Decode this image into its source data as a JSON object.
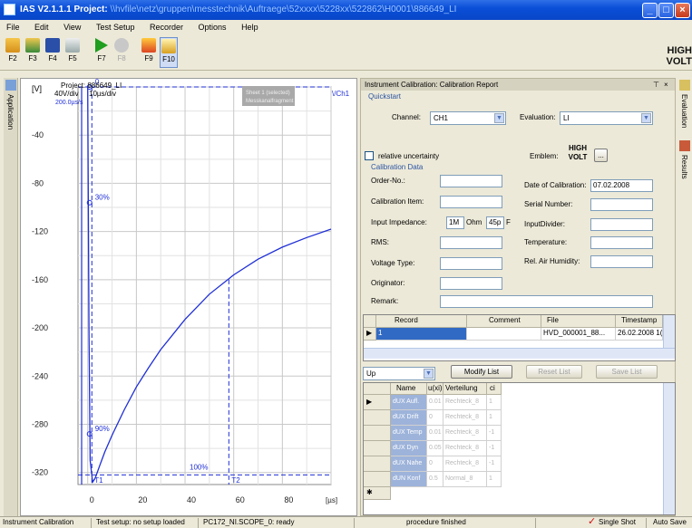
{
  "window": {
    "title_app": "IAS V2.1.1.1 Project: ",
    "title_path": "\\\\hvfile\\netz\\gruppen\\messtechnik\\Auftraege\\52xxxx\\5228xx\\522862\\H0001\\886649_LI",
    "minimize": "_",
    "maximize": "□",
    "close": "×"
  },
  "menu": [
    "File",
    "Edit",
    "View",
    "Test Setup",
    "Recorder",
    "Options",
    "Help"
  ],
  "toolbar": [
    {
      "key": "F2",
      "icon": "open-icon"
    },
    {
      "key": "F3",
      "icon": "save-as-icon"
    },
    {
      "key": "F4",
      "icon": "save-icon"
    },
    {
      "key": "F5",
      "icon": "print-icon"
    },
    {
      "key": "F7",
      "icon": "run-icon"
    },
    {
      "key": "F8",
      "icon": "stop-icon"
    },
    {
      "key": "F9",
      "icon": "calibration-icon"
    },
    {
      "key": "F10",
      "icon": "report-icon"
    }
  ],
  "brand": {
    "line1": "HIGH",
    "line2": "VOLT"
  },
  "left_strip": {
    "label": "Application"
  },
  "plot": {
    "unit_y": "[V]",
    "project": "Project: 886649_LI",
    "scale": "40V/div",
    "timebase": "10µs/div",
    "offset": "200.0µs/s",
    "channel": "\\/Ch1",
    "sheet": "Sheet 1 (selected)",
    "sheet2": "Messkanalfragment",
    "y_ticks": [
      "-40",
      "-80",
      "-120",
      "-160",
      "-200",
      "-240",
      "-280",
      "-320"
    ],
    "x_ticks": [
      "0",
      "20",
      "40",
      "60",
      "80"
    ],
    "x_unit": "[µs]",
    "markers": {
      "p0": "0",
      "p30": "30%",
      "p90": "90%",
      "p100": "100%",
      "t1": "T1",
      "t2": "T2"
    },
    "line_color": "#1f2fd6"
  },
  "chart_data": {
    "type": "line",
    "title": "",
    "xlabel": "[µs]",
    "ylabel": "[V]",
    "xlim": [
      -4,
      100
    ],
    "ylim": [
      -330,
      0
    ],
    "series": [
      {
        "x": [
          0,
          0.5,
          1,
          2,
          3,
          5,
          7,
          10,
          15,
          20,
          25,
          30,
          40,
          50,
          60,
          70,
          80,
          90,
          100
        ],
        "y": [
          0,
          -200,
          -310,
          -328,
          -325,
          -314,
          -303,
          -289,
          -268,
          -249,
          -233,
          -218,
          -193,
          -172,
          -156,
          -143,
          -133,
          -125,
          -118
        ]
      }
    ]
  },
  "report": {
    "header": "Instrument Calibration: Calibration Report",
    "pin": "⊤",
    "close": "×",
    "quickstart": "Quickstart",
    "channel_label": "Channel:",
    "channel_value": "CH1",
    "evaluation_label": "Evaluation:",
    "evaluation_value": "LI",
    "relative_uncertainty": "relative uncertainty",
    "emblem_label": "Emblem:",
    "emblem_btn": "...",
    "calibration_data": "Calibration Data",
    "fields_left": [
      {
        "label": "Order-No.:",
        "value": ""
      },
      {
        "label": "Calibration Item:",
        "value": ""
      },
      {
        "label": "Input Impedance:",
        "value": ""
      },
      {
        "label": "RMS:",
        "value": ""
      },
      {
        "label": "Voltage Type:",
        "value": ""
      },
      {
        "label": "Originator:",
        "value": ""
      },
      {
        "label": "Remark:",
        "value": ""
      }
    ],
    "impedance": {
      "r": "1M",
      "r_unit": "Ohm",
      "c": "45p",
      "c_unit": "F"
    },
    "fields_right": [
      {
        "label": "Date of Calibration:",
        "value": "07.02.2008"
      },
      {
        "label": "Serial Number:",
        "value": ""
      },
      {
        "label": "InputDivider:",
        "value": ""
      },
      {
        "label": "Temperature:",
        "value": ""
      },
      {
        "label": "Rel. Air Humidity:",
        "value": ""
      }
    ],
    "records": {
      "headers": [
        "Record",
        "Comment",
        "File",
        "Timestamp"
      ],
      "rows": [
        {
          "record": "1",
          "comment": "",
          "file": "HVD_000001_88...",
          "timestamp": "26.02.2008 1("
        }
      ]
    },
    "list_select": "Up",
    "modify_list": "Modify List",
    "reset_list": "Reset List",
    "save_list": "Save List",
    "unc": {
      "headers": [
        "Name",
        "u(xi)",
        "Verteilung",
        "ci"
      ],
      "rows": [
        {
          "name": "dUX Aufl.",
          "u": "0.01",
          "dist": "Rechteck_8",
          "ci": "1"
        },
        {
          "name": "dUX Drift",
          "u": "0",
          "dist": "Rechteck_8",
          "ci": "1"
        },
        {
          "name": "dUX Temp",
          "u": "0.01",
          "dist": "Rechteck_8",
          "ci": "-1"
        },
        {
          "name": "dUX Dyn",
          "u": "0.05",
          "dist": "Rechteck_8",
          "ci": "-1"
        },
        {
          "name": "dUX Nahe",
          "u": "0",
          "dist": "Rechteck_8",
          "ci": "-1"
        },
        {
          "name": "dUN Konf",
          "u": "0.5",
          "dist": "Normal_8",
          "ci": "1"
        }
      ],
      "new_row": "✱"
    }
  },
  "right_strip": {
    "evaluation": "Evaluation",
    "results": "Results"
  },
  "status": {
    "s1": "Instrument Calibration",
    "s2": "Test setup: no setup loaded",
    "s3": "PC172_NI.SCOPE_0: ready",
    "s4": "procedure finished",
    "s5": "Single Shot",
    "s6": "Auto Save",
    "check": "✓"
  }
}
